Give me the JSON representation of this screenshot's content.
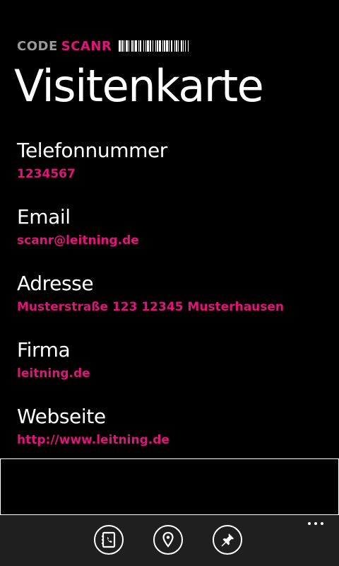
{
  "colors": {
    "accent": "#e0157a",
    "brand_gray": "#9a9a9a",
    "background": "#000000",
    "app_bar": "#1f1f1f"
  },
  "header": {
    "brand_code": "CODE",
    "brand_scanr": "SCANR"
  },
  "page": {
    "title": "Visitenkarte"
  },
  "fields": [
    {
      "label": "Telefonnummer",
      "value": "1234567"
    },
    {
      "label": "Email",
      "value": "scanr@leitning.de"
    },
    {
      "label": "Adresse",
      "value": "Musterstraße 123 12345 Musterhausen"
    },
    {
      "label": "Firma",
      "value": "leitning.de"
    },
    {
      "label": "Webseite",
      "value": "http://www.leitning.de"
    }
  ],
  "app_bar": {
    "buttons": [
      {
        "icon": "contact-card-phone-icon"
      },
      {
        "icon": "map-pin-icon"
      },
      {
        "icon": "pushpin-icon"
      }
    ],
    "more_icon": "ellipsis-icon"
  }
}
